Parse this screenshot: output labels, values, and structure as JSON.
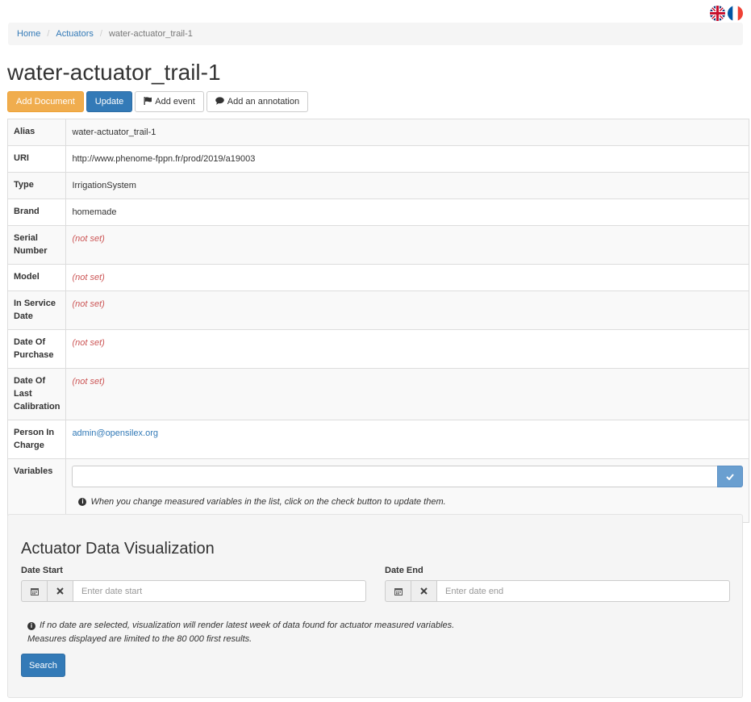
{
  "languages": [
    "English",
    "Français"
  ],
  "breadcrumb": {
    "home": "Home",
    "actuators": "Actuators",
    "current": "water-actuator_trail-1"
  },
  "page_title": "water-actuator_trail-1",
  "actions": {
    "add_document": "Add Document",
    "update": "Update",
    "add_event": "Add event",
    "add_annotation": "Add an annotation"
  },
  "details": {
    "alias_label": "Alias",
    "alias_value": "water-actuator_trail-1",
    "uri_label": "URI",
    "uri_value": "http://www.phenome-fppn.fr/prod/2019/a19003",
    "type_label": "Type",
    "type_value": "IrrigationSystem",
    "brand_label": "Brand",
    "brand_value": "homemade",
    "serial_label": "Serial Number",
    "model_label": "Model",
    "in_service_label": "In Service Date",
    "purchase_label": "Date Of Purchase",
    "calibration_label": "Date Of Last Calibration",
    "not_set": "(not set)",
    "person_label": "Person In Charge",
    "person_value": "admin@opensilex.org",
    "variables_label": "Variables",
    "variables_hint": "When you change measured variables in the list, click on the check button to update them."
  },
  "visualization": {
    "title": "Actuator Data Visualization",
    "date_start_label": "Date Start",
    "date_start_placeholder": "Enter date start",
    "date_end_label": "Date End",
    "date_end_placeholder": "Enter date end",
    "note_line1": "If no date are selected, visualization will render latest week of data found for actuator measured variables.",
    "note_line2": "Measures displayed are limited to the 80 000 first results.",
    "search_label": "Search"
  },
  "colors": {
    "primary": "#337ab7",
    "warning": "#f0ad4e",
    "not_set": "#cc5555"
  }
}
